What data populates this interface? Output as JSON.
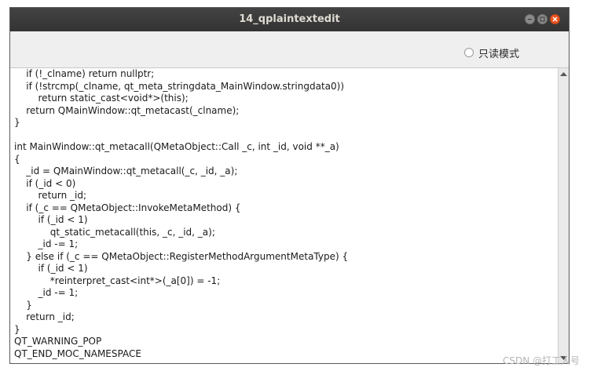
{
  "window": {
    "title": "14_qplaintextedit"
  },
  "toolbar": {
    "readonly_label": "只读模式",
    "readonly_checked": false
  },
  "editor": {
    "lines": [
      "    if (!_clname) return nullptr;",
      "    if (!strcmp(_clname, qt_meta_stringdata_MainWindow.stringdata0))",
      "        return static_cast<void*>(this);",
      "    return QMainWindow::qt_metacast(_clname);",
      "}",
      "",
      "int MainWindow::qt_metacall(QMetaObject::Call _c, int _id, void **_a)",
      "{",
      "    _id = QMainWindow::qt_metacall(_c, _id, _a);",
      "    if (_id < 0)",
      "        return _id;",
      "    if (_c == QMetaObject::InvokeMetaMethod) {",
      "        if (_id < 1)",
      "            qt_static_metacall(this, _c, _id, _a);",
      "        _id -= 1;",
      "    } else if (_c == QMetaObject::RegisterMethodArgumentMetaType) {",
      "        if (_id < 1)",
      "            *reinterpret_cast<int*>(_a[0]) = -1;",
      "        _id -= 1;",
      "    }",
      "    return _id;",
      "}",
      "QT_WARNING_POP",
      "QT_END_MOC_NAMESPACE"
    ]
  },
  "watermark": {
    "text": "CSDN @打工人号"
  },
  "colors": {
    "titlebar": "#3c3c3c",
    "close_button": "#e9541f",
    "link_blue": "#3a6ea5"
  }
}
